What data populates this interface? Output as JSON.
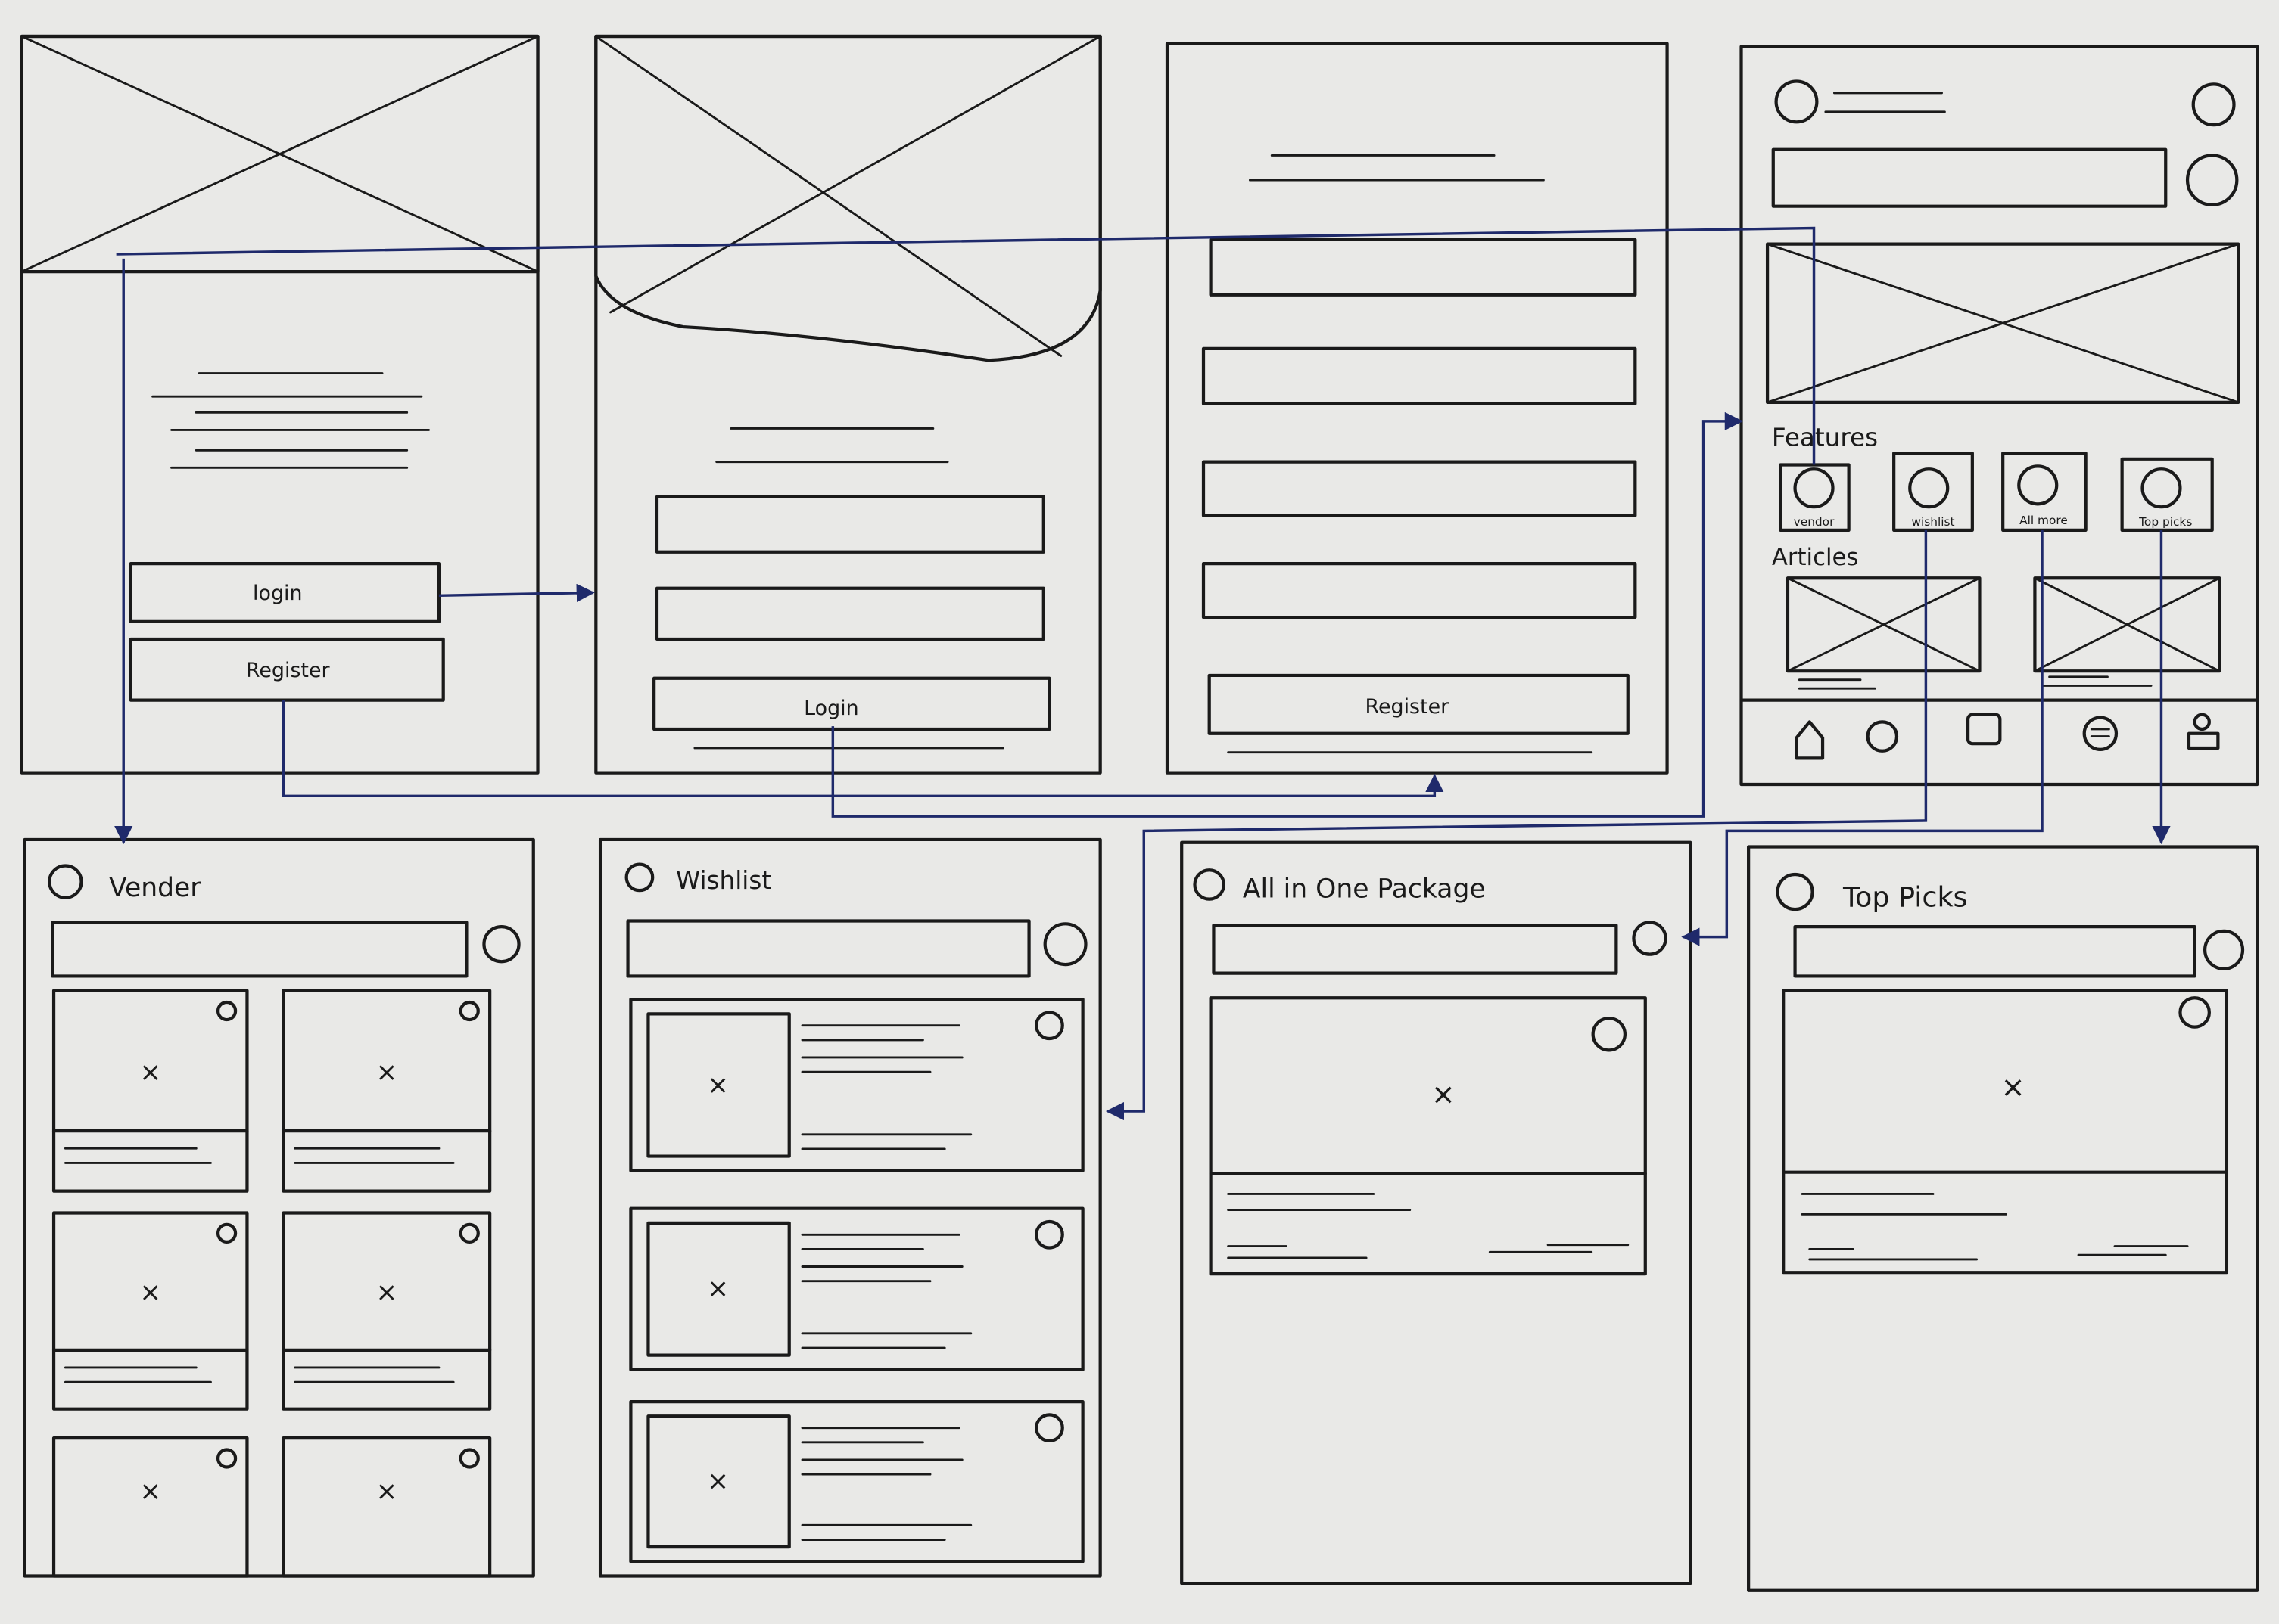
{
  "colors": {
    "paper": "#e9e9e7",
    "ink": "#1a1a1a",
    "flow_arrows": "#1f2a6b"
  },
  "screens": {
    "onboarding": {
      "login_button": "login",
      "register_button": "Register"
    },
    "login": {
      "login_button": "Login"
    },
    "register": {
      "register_button": "Register"
    },
    "home": {
      "features_heading": "Features",
      "features": [
        {
          "label": "vendor",
          "icon": "circle-icon"
        },
        {
          "label": "wishlist",
          "icon": "circle-icon"
        },
        {
          "label": "All more",
          "icon": "circle-icon"
        },
        {
          "label": "Top picks",
          "icon": "circle-icon"
        }
      ],
      "articles_heading": "Articles",
      "bottom_nav": [
        "home-icon",
        "circle-icon",
        "square-icon",
        "chat-icon",
        "profile-icon"
      ]
    },
    "vendor": {
      "title": "Vender"
    },
    "wishlist": {
      "title": "Wishlist"
    },
    "package": {
      "title": "All in One Package"
    },
    "top_picks": {
      "title": "Top Picks"
    }
  }
}
